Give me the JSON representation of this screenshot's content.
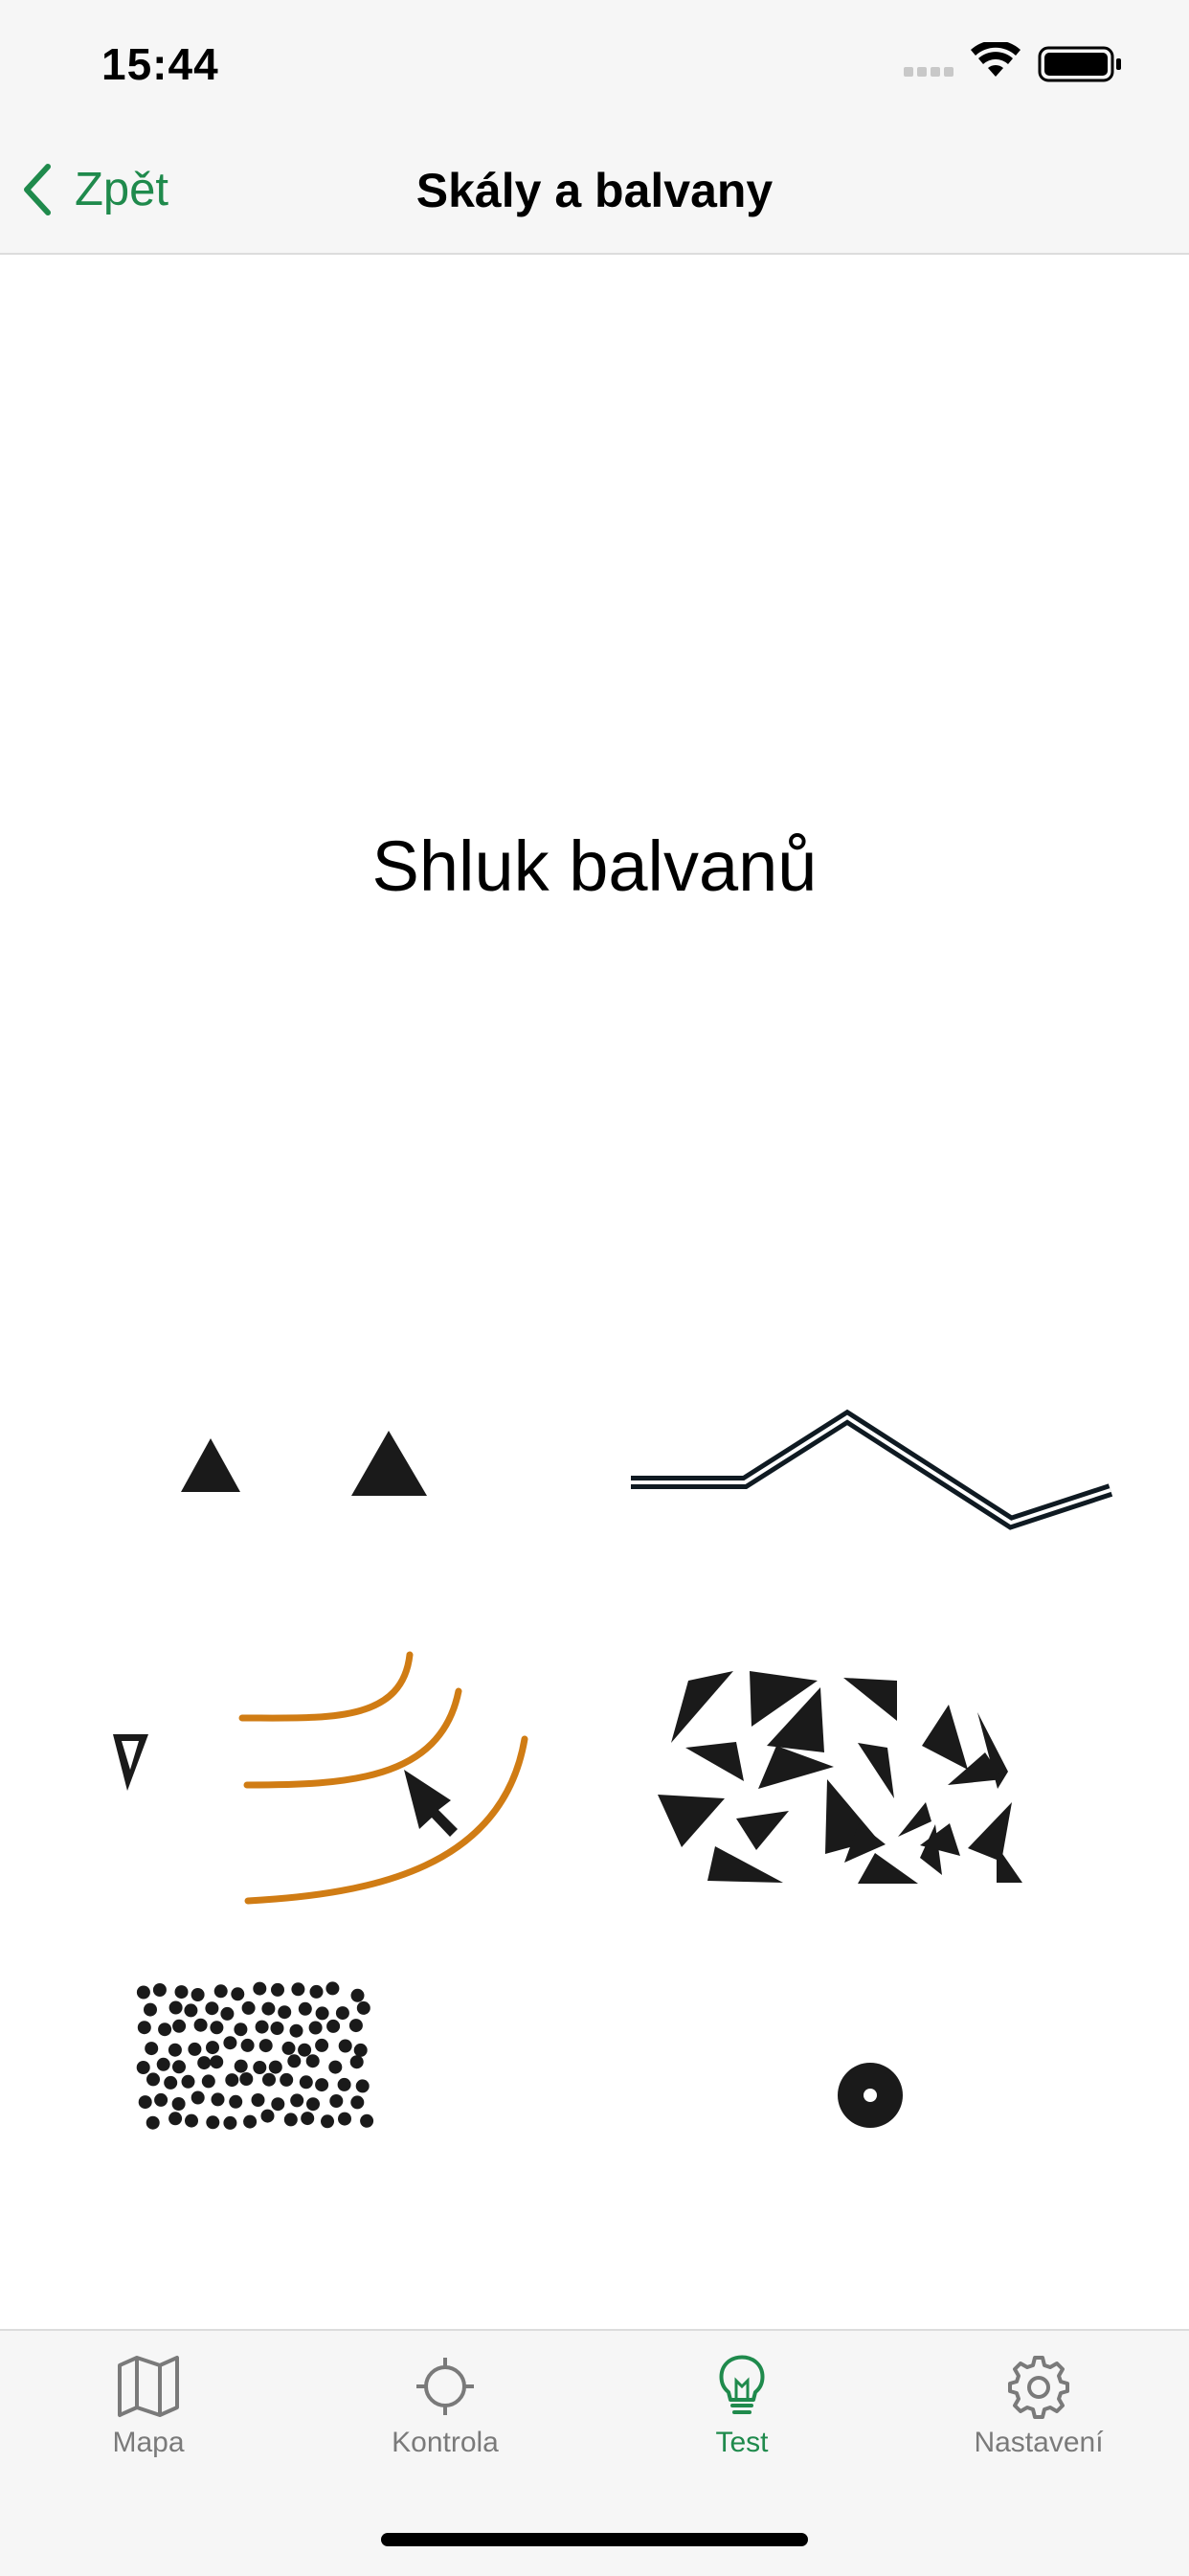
{
  "status_bar": {
    "time": "15:44"
  },
  "nav": {
    "back_label": "Zpět",
    "title": "Skály a balvany"
  },
  "question": {
    "text": "Shluk balvanů"
  },
  "answers": [
    {
      "id": "two-triangles",
      "icon": "boulder-triangles-symbol"
    },
    {
      "id": "impassable-cliff-line",
      "icon": "double-line-cliff-symbol"
    },
    {
      "id": "gully-with-arrows",
      "icon": "earth-bank-arrows-symbol"
    },
    {
      "id": "boulder-field",
      "icon": "scattered-triangles-symbol"
    },
    {
      "id": "stony-ground",
      "icon": "dense-dots-symbol"
    },
    {
      "id": "ring-dot",
      "icon": "ring-dot-symbol"
    }
  ],
  "tabs": [
    {
      "label": "Mapa",
      "icon": "map-icon",
      "active": false
    },
    {
      "label": "Kontrola",
      "icon": "crosshair-icon",
      "active": false
    },
    {
      "label": "Test",
      "icon": "lightbulb-icon",
      "active": true
    },
    {
      "label": "Nastavení",
      "icon": "gear-icon",
      "active": false
    }
  ],
  "colors": {
    "accent": "#1f8a4c",
    "contour": "#d07c14",
    "symbol": "#1a1a1a"
  }
}
